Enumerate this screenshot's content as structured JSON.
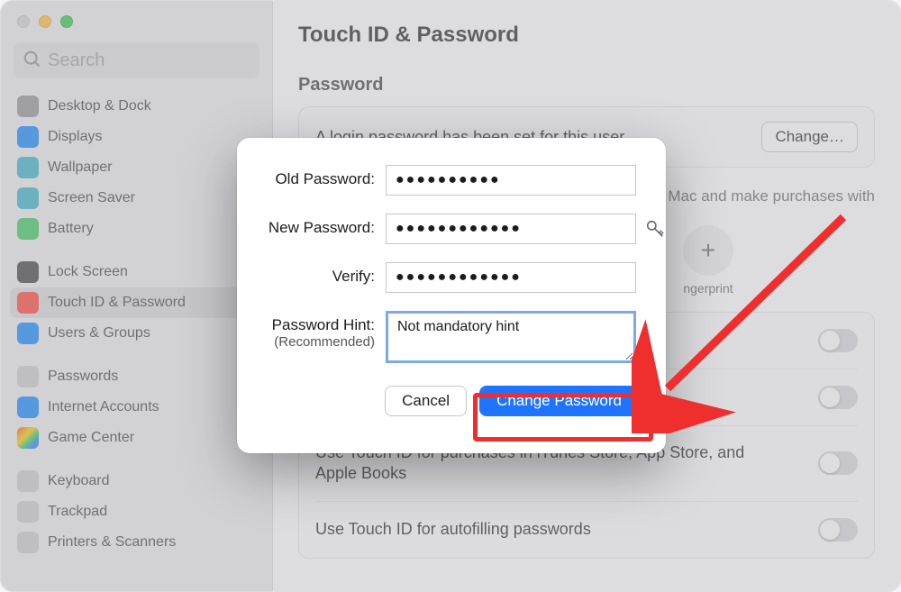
{
  "window": {
    "title": "Touch ID & Password"
  },
  "search": {
    "placeholder": "Search"
  },
  "sidebar": {
    "groups": [
      [
        {
          "icon": "desktop-icon",
          "color": "ic-gray",
          "label": "Desktop & Dock"
        },
        {
          "icon": "displays-icon",
          "color": "ic-blue",
          "label": "Displays"
        },
        {
          "icon": "wallpaper-icon",
          "color": "ic-teal",
          "label": "Wallpaper"
        },
        {
          "icon": "saver-icon",
          "color": "ic-teal",
          "label": "Screen Saver"
        },
        {
          "icon": "battery-icon",
          "color": "ic-green",
          "label": "Battery"
        }
      ],
      [
        {
          "icon": "lock-icon",
          "color": "ic-dark",
          "label": "Lock Screen"
        },
        {
          "icon": "touchid-icon",
          "color": "ic-red",
          "label": "Touch ID & Password",
          "selected": true
        },
        {
          "icon": "users-icon",
          "color": "ic-blue",
          "label": "Users & Groups"
        }
      ],
      [
        {
          "icon": "passwords-icon",
          "color": "ic-silver",
          "label": "Passwords"
        },
        {
          "icon": "internet-icon",
          "color": "ic-blue",
          "label": "Internet Accounts"
        },
        {
          "icon": "gamectr-icon",
          "color": "ic-rainbow",
          "label": "Game Center"
        }
      ],
      [
        {
          "icon": "keyboard-icon",
          "color": "ic-silver",
          "label": "Keyboard"
        },
        {
          "icon": "trackpad-icon",
          "color": "ic-silver",
          "label": "Trackpad"
        },
        {
          "icon": "printers-icon",
          "color": "ic-silver",
          "label": "Printers & Scanners"
        }
      ]
    ]
  },
  "main": {
    "section1_label": "Password",
    "login_set_text": "A login password has been set for this user",
    "change_button": "Change…",
    "touch_descr": "Mac and make purchases with",
    "add_fingerprint": "ngerprint",
    "toggles": [
      "",
      "",
      "Use Touch ID for purchases in iTunes Store, App Store, and Apple Books",
      "Use Touch ID for autofilling passwords"
    ]
  },
  "modal": {
    "old_label": "Old Password:",
    "old_value": "●●●●●●●●●●",
    "new_label": "New Password:",
    "new_value": "●●●●●●●●●●●●",
    "verify_label": "Verify:",
    "verify_value": "●●●●●●●●●●●●",
    "hint_label": "Password Hint:",
    "hint_sublabel": "(Recommended)",
    "hint_value": "Not mandatory hint",
    "cancel": "Cancel",
    "change": "Change Password"
  }
}
